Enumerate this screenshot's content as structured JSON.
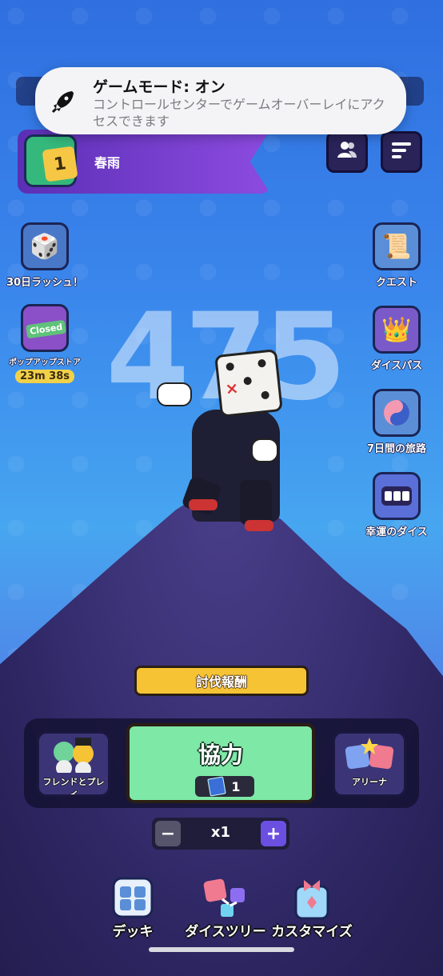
{
  "notification": {
    "title": "ゲームモード: オン",
    "body": "コントロールセンターでゲームオーバーレイにアクセスできます",
    "icon": "rocket-icon"
  },
  "profile": {
    "name": "春雨",
    "level_badge": "1"
  },
  "header": {
    "friends_icon": "friends-icon",
    "menu_icon": "menu-icon"
  },
  "left_side": [
    {
      "label": "30日ラッシュ！",
      "icon": "dice-pack-icon"
    },
    {
      "label": "ポップアップストア",
      "badge": "Closed",
      "timer": "23m 38s",
      "icon": "popup-store-icon"
    }
  ],
  "right_side": [
    {
      "label": "クエスト",
      "icon": "scroll-icon"
    },
    {
      "label": "ダイスパス",
      "icon": "crown-icon"
    },
    {
      "label": "7日間の旅路",
      "icon": "journey-icon"
    },
    {
      "label": "幸運のダイス",
      "icon": "lucky-dice-icon"
    }
  ],
  "score": "475",
  "reward_button": "討伐報酬",
  "modes": {
    "left": {
      "label": "フレンドとプレイ"
    },
    "center": {
      "label": "協力",
      "ticket_count": "1"
    },
    "right": {
      "label": "アリーナ"
    }
  },
  "multiplier": {
    "value": "x1",
    "minus": "−",
    "plus": "+"
  },
  "bottom_nav": [
    {
      "label": "デッキ",
      "icon": "deck-icon"
    },
    {
      "label": "ダイスツリー",
      "icon": "dice-tree-icon"
    },
    {
      "label": "カスタマイズ",
      "icon": "customize-icon"
    }
  ],
  "colors": {
    "accent_green": "#7ee8a6",
    "reward_yellow": "#f6c335",
    "purple": "#6b4fe0"
  }
}
